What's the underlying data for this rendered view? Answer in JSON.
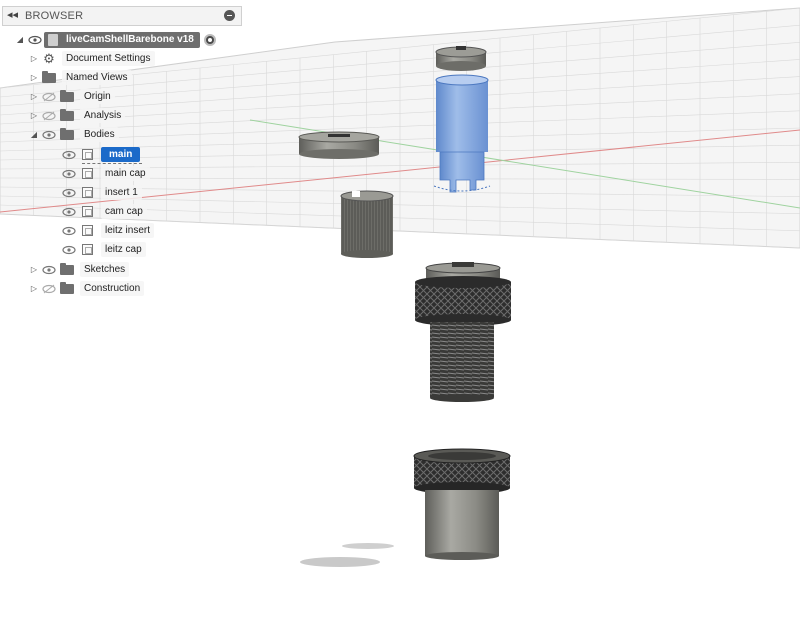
{
  "browser": {
    "title": "BROWSER",
    "collapse_icon": "◂◂",
    "root": {
      "label": "liveCamShellBarebone v18"
    },
    "items": [
      {
        "label": "Document Settings"
      },
      {
        "label": "Named Views"
      },
      {
        "label": "Origin"
      },
      {
        "label": "Analysis"
      },
      {
        "label": "Bodies"
      },
      {
        "label": "Sketches"
      },
      {
        "label": "Construction"
      }
    ],
    "bodies": [
      {
        "label": "main",
        "selected": true
      },
      {
        "label": "main cap"
      },
      {
        "label": "insert 1"
      },
      {
        "label": "cam cap"
      },
      {
        "label": "leitz insert"
      },
      {
        "label": "leitz cap"
      }
    ]
  },
  "colors": {
    "selection": "#1b6ac9",
    "body_blue": "#7ea6e0",
    "metal": "#8c8c86",
    "knurl": "#2b2b2b"
  },
  "icons": [
    "eye-icon",
    "eye-off-icon",
    "folder-icon",
    "gear-icon",
    "body-icon",
    "close-icon",
    "collapse-icon",
    "expand-triangle-icon",
    "activate-radio-icon"
  ]
}
